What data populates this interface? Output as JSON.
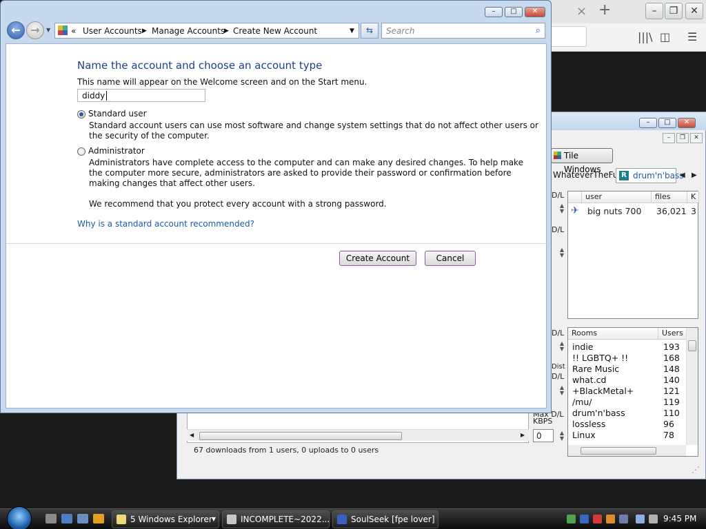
{
  "firefox": {
    "tab_close": "×",
    "tab_new": "+"
  },
  "soulseek": {
    "toolbar": {
      "tile_windows": "Tile Windows"
    },
    "chat_tabs": {
      "tab1": "WhateverTheFu",
      "tab2": "drum'n'bass"
    },
    "users_table": {
      "headers": [
        "user",
        "files",
        "K"
      ],
      "rows": [
        {
          "user": "big nuts 700",
          "files": "36,021",
          "k": "3"
        }
      ]
    },
    "rooms_table": {
      "headers": [
        "Rooms",
        "Users"
      ],
      "rows": [
        {
          "room": "indie",
          "users": "193"
        },
        {
          "room": "!! LGBTQ+ !!",
          "users": "168"
        },
        {
          "room": "Rare Music",
          "users": "148"
        },
        {
          "room": "what.cd",
          "users": "140"
        },
        {
          "room": "+BlackMetal+",
          "users": "121"
        },
        {
          "room": "/mu/",
          "users": "119"
        },
        {
          "room": "drum'n'bass",
          "users": "110"
        },
        {
          "room": "lossless",
          "users": "96"
        },
        {
          "room": "Linux",
          "users": "78"
        }
      ]
    },
    "left_labels": [
      "D/L",
      "D/L",
      "D/L",
      "Dist",
      "D/L",
      "Max D/L",
      "KBPS"
    ],
    "kbps_value": "0",
    "status": "67 downloads from 1 users, 0 uploads to 0 users"
  },
  "explorer": {
    "breadcrumb": {
      "root": "«",
      "item1": "User Accounts",
      "item2": "Manage Accounts",
      "item3": "Create New Account"
    },
    "search_placeholder": "Search",
    "heading": "Name the account and choose an account type",
    "name_hint": "This name will appear on the Welcome screen and on the Start menu.",
    "name_value": "diddy",
    "standard": {
      "label": "Standard user",
      "line1": "Standard account users can use most software and change system settings that do not affect other users or",
      "line2": "the security of the computer."
    },
    "admin": {
      "label": "Administrator",
      "line1": "Administrators have complete access to the computer and can make any desired changes. To help make",
      "line2": "the computer more secure, administrators are asked to provide their password or confirmation before",
      "line3": "making changes that affect other users."
    },
    "recommend": "We recommend that you protect every account with a strong password.",
    "why_link": "Why is a standard account recommended?",
    "create_button": "Create Account",
    "cancel_button": "Cancel"
  },
  "taskbar": {
    "items": [
      {
        "label": "5 Windows Explorer"
      },
      {
        "label": "INCOMPLETE~2022..."
      },
      {
        "label": "SoulSeek [fpe lover] ..."
      }
    ],
    "clock": "9:45 PM"
  },
  "colors": {
    "accent": "#1e3f8a",
    "link": "#1a5aa8",
    "taskbar": "#0c0c0c"
  }
}
